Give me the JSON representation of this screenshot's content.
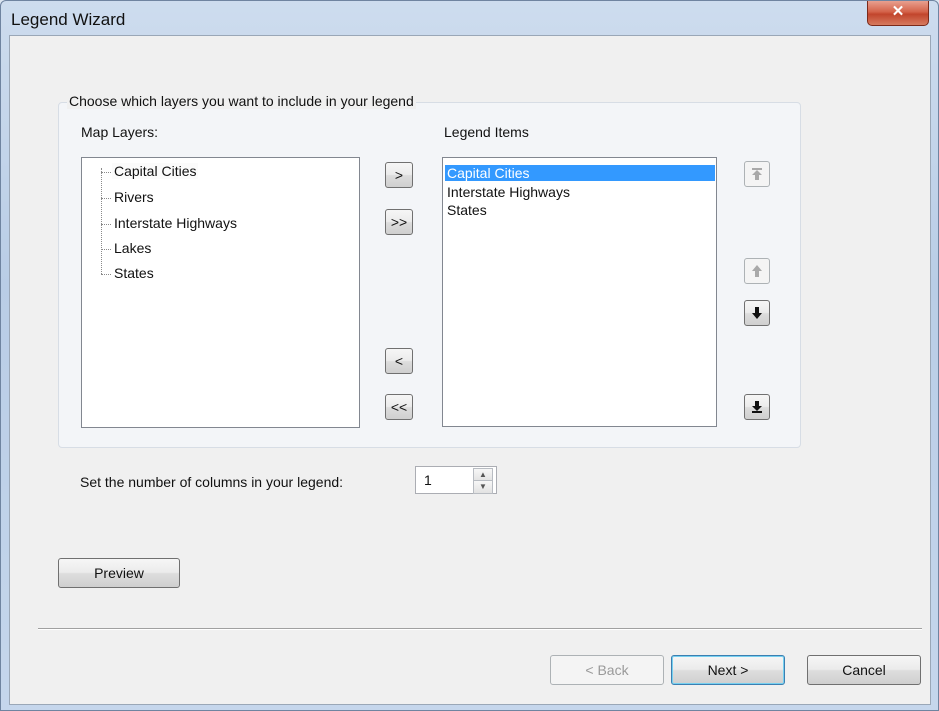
{
  "window": {
    "title": "Legend Wizard",
    "close_glyph": "✕"
  },
  "group": {
    "title": "Choose which layers you want to include in your legend",
    "map_layers_label": "Map Layers:",
    "legend_items_label": "Legend Items",
    "map_layers": [
      "Capital Cities",
      "Rivers",
      "Interstate Highways",
      "Lakes",
      "States"
    ],
    "selected_map_layer": "Capital Cities",
    "legend_items": [
      "Capital Cities",
      "Interstate Highways",
      "States"
    ],
    "selected_legend_item": "Capital Cities"
  },
  "transfer_buttons": {
    "add": ">",
    "add_all": ">>",
    "remove": "<",
    "remove_all": "<<"
  },
  "order_buttons": {
    "move_top_icon": "move-to-top-icon",
    "move_up_icon": "move-up-icon",
    "move_down_icon": "move-down-icon",
    "move_bottom_icon": "move-to-bottom-icon"
  },
  "columns": {
    "label": "Set the number of columns in your legend:",
    "value": "1"
  },
  "buttons": {
    "preview": "Preview",
    "back": "< Back",
    "next": "Next >",
    "cancel": "Cancel"
  },
  "colors": {
    "selection": "#3399ff",
    "close_button": "#c9513a"
  }
}
